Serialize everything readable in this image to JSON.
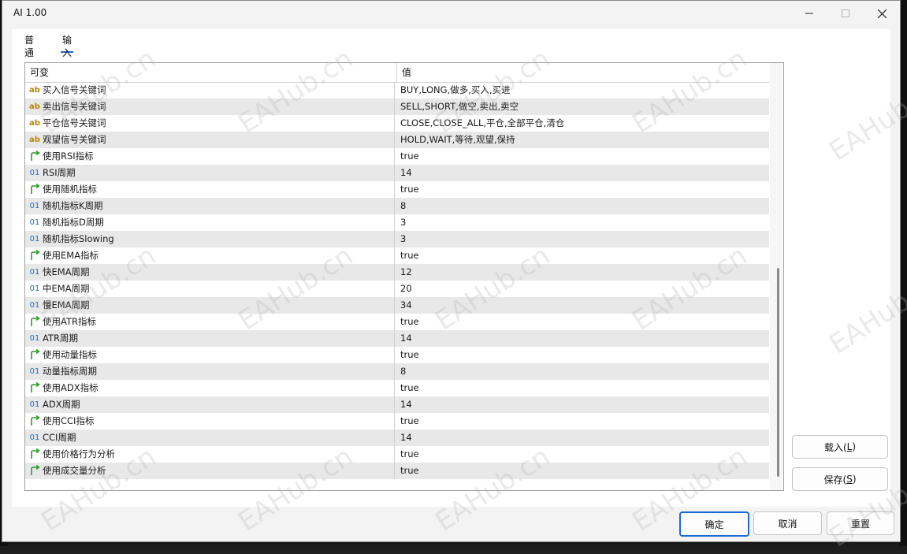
{
  "window": {
    "title": "AI 1.00"
  },
  "tabs": [
    {
      "label": "普通"
    },
    {
      "label": "输入"
    }
  ],
  "grid": {
    "header_name": "可变",
    "header_value": "值",
    "rows": [
      {
        "icon": "ab",
        "name": "买入信号关键词",
        "value": "BUY,LONG,做多,买入,买进"
      },
      {
        "icon": "ab",
        "name": "卖出信号关键词",
        "value": "SELL,SHORT,做空,卖出,卖空"
      },
      {
        "icon": "ab",
        "name": "平仓信号关键词",
        "value": "CLOSE,CLOSE_ALL,平仓,全部平仓,清仓"
      },
      {
        "icon": "ab",
        "name": "观望信号关键词",
        "value": "HOLD,WAIT,等待,观望,保持"
      },
      {
        "icon": "bool",
        "name": "使用RSI指标",
        "value": "true"
      },
      {
        "icon": "01",
        "name": "RSI周期",
        "value": "14"
      },
      {
        "icon": "bool",
        "name": "使用随机指标",
        "value": "true"
      },
      {
        "icon": "01",
        "name": "随机指标K周期",
        "value": "8"
      },
      {
        "icon": "01",
        "name": "随机指标D周期",
        "value": "3"
      },
      {
        "icon": "01",
        "name": "随机指标Slowing",
        "value": "3"
      },
      {
        "icon": "bool",
        "name": "使用EMA指标",
        "value": "true"
      },
      {
        "icon": "01",
        "name": "快EMA周期",
        "value": "12"
      },
      {
        "icon": "01",
        "name": "中EMA周期",
        "value": "20"
      },
      {
        "icon": "01",
        "name": "慢EMA周期",
        "value": "34"
      },
      {
        "icon": "bool",
        "name": "使用ATR指标",
        "value": "true"
      },
      {
        "icon": "01",
        "name": "ATR周期",
        "value": "14"
      },
      {
        "icon": "bool",
        "name": "使用动量指标",
        "value": "true"
      },
      {
        "icon": "01",
        "name": "动量指标周期",
        "value": "8"
      },
      {
        "icon": "bool",
        "name": "使用ADX指标",
        "value": "true"
      },
      {
        "icon": "01",
        "name": "ADX周期",
        "value": "14"
      },
      {
        "icon": "bool",
        "name": "使用CCI指标",
        "value": "true"
      },
      {
        "icon": "01",
        "name": "CCI周期",
        "value": "14"
      },
      {
        "icon": "bool",
        "name": "使用价格行为分析",
        "value": "true"
      },
      {
        "icon": "bool",
        "name": "使用成交量分析",
        "value": "true"
      }
    ]
  },
  "buttons": {
    "load": {
      "label": "载入(",
      "hotkey": "L",
      "end": ")"
    },
    "save": {
      "label": "保存(",
      "hotkey": "S",
      "end": ")"
    },
    "ok": "确定",
    "cancel": "取消",
    "reset": "重置"
  },
  "watermark": "EAHub.cn",
  "colors": {
    "accent": "#1c6bd1",
    "string_icon": "#b8860b",
    "int_icon": "#1f6fc4",
    "bool_icon": "#2a9d2a"
  }
}
